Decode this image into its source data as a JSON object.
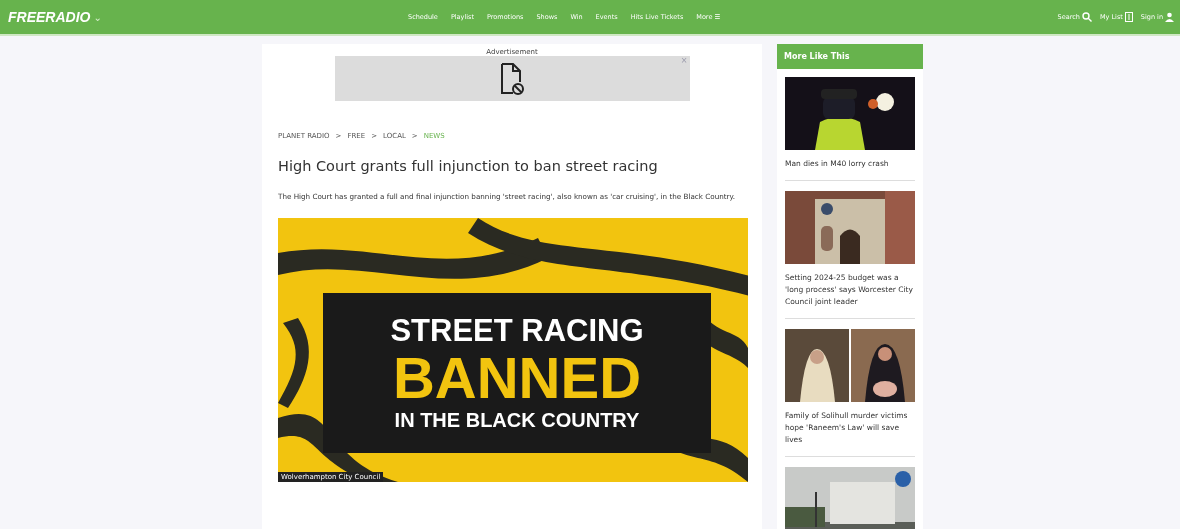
{
  "header": {
    "logo": "FREERADIO",
    "logo_caret": "⌄",
    "nav": [
      "Schedule",
      "Playlist",
      "Promotions",
      "Shows",
      "Win",
      "Events",
      "Hits Live Tickets",
      "More ☰"
    ],
    "actions": [
      {
        "label": "Search",
        "kind": "search"
      },
      {
        "label": "My List",
        "kind": "list"
      },
      {
        "label": "Sign in",
        "kind": "user"
      }
    ]
  },
  "advert": {
    "label": "Advertisement",
    "close": "×"
  },
  "breadcrumbs": [
    {
      "label": "PLANET RADIO",
      "selected": false
    },
    {
      "label": "FREE",
      "selected": false
    },
    {
      "label": "LOCAL",
      "selected": false
    },
    {
      "label": "NEWS",
      "selected": true
    }
  ],
  "breadcrumb_separator": ">",
  "article": {
    "title": "High Court grants full injunction to ban street racing",
    "summary": "The High Court has granted a full and final injunction banning 'street racing', also known as 'car cruising', in the Black Country.",
    "image": {
      "lines": [
        "STREET RACING",
        "BANNED",
        "IN THE BLACK COUNTRY"
      ],
      "caption": "Wolverhampton City Council"
    }
  },
  "sidebar": {
    "title": "More Like This",
    "items": [
      {
        "kind": "police",
        "headline": "Man dies in M40 lorry crash"
      },
      {
        "kind": "building",
        "headline": "Setting 2024-25 budget was a 'long process' says Worcester City Council joint leader"
      },
      {
        "kind": "people",
        "headline": "Family of Solihull murder victims hope 'Raneem's Law' will save lives"
      },
      {
        "kind": "lorry"
      }
    ]
  }
}
